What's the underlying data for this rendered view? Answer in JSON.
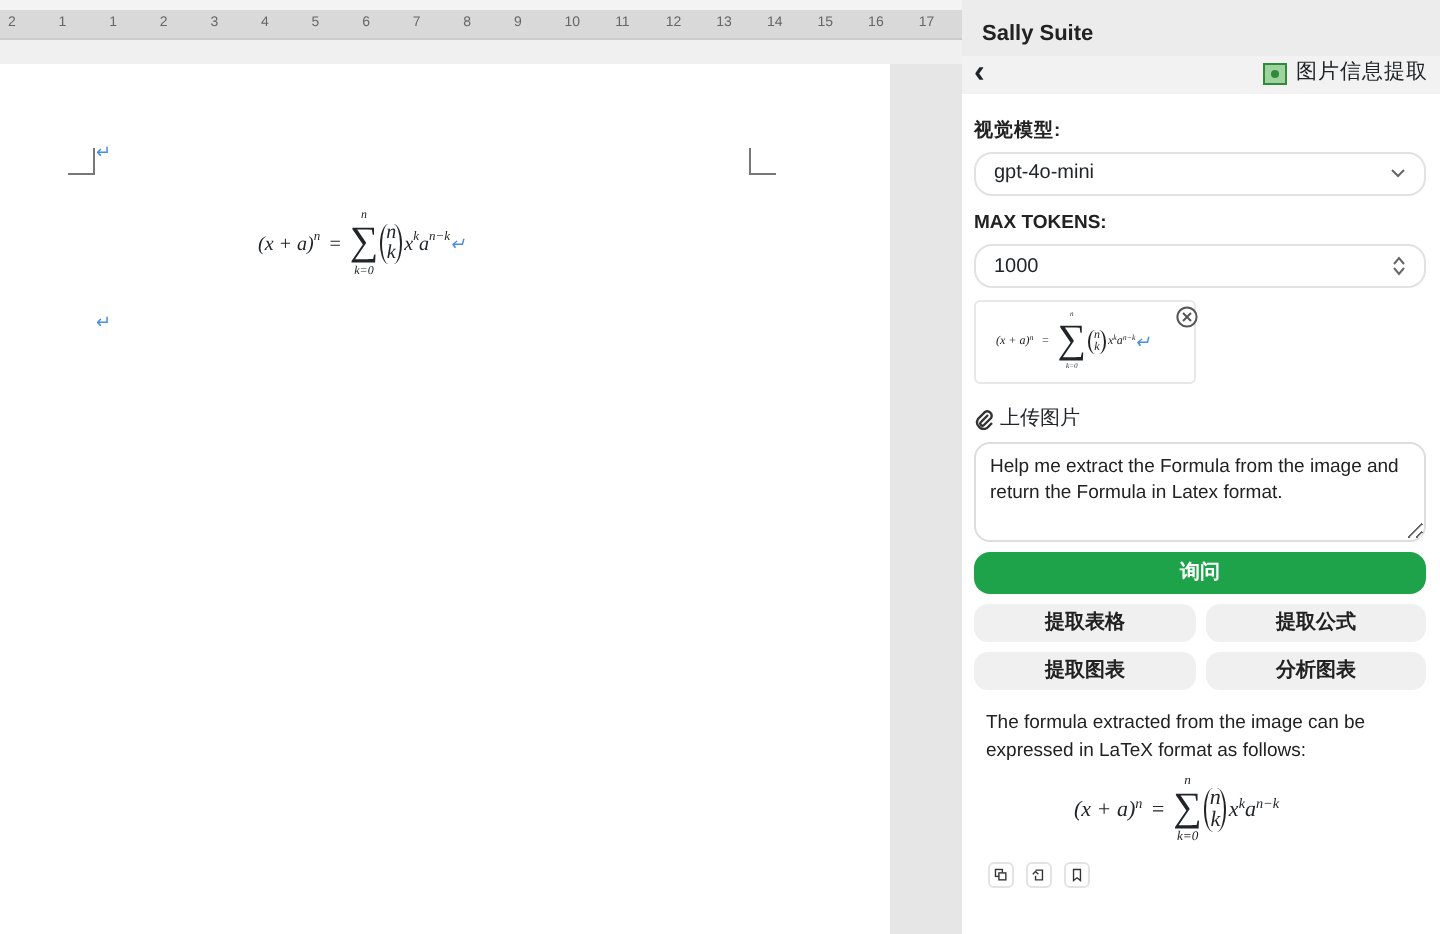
{
  "ruler": {
    "ticks": [
      "2",
      "1",
      "1",
      "2",
      "3",
      "4",
      "5",
      "6",
      "7",
      "8",
      "9",
      "10",
      "11",
      "12",
      "13",
      "14",
      "15",
      "16",
      "17"
    ]
  },
  "document": {
    "paragraph_marks": [
      "↵",
      "↵"
    ],
    "formula": {
      "lhs": "(x + a)",
      "lhs_exp": "n",
      "op": "=",
      "sum": "∑",
      "sum_upper": "n",
      "sum_lower": "k=0",
      "binom_top": "n",
      "binom_bottom": "k",
      "term": "x",
      "term_exp": "k",
      "term2": "a",
      "term2_exp": "n−k",
      "end_mark": "↵"
    }
  },
  "panel": {
    "title": "Sally Suite",
    "back": "‹",
    "feature": "图片信息提取",
    "model_label": "视觉模型:",
    "model_value": "gpt-4o-mini",
    "tokens_label": "MAX TOKENS:",
    "tokens_value": "1000",
    "thumbnail": {
      "lhs": "(x + a)",
      "lhs_exp": "n",
      "op": "=",
      "sum": "∑",
      "sum_upper": "n",
      "sum_lower": "k=0",
      "binom_top": "n",
      "binom_bottom": "k",
      "term": "x",
      "term_exp": "k",
      "term2": "a",
      "term2_exp": "n−k",
      "end_mark": "↵"
    },
    "upload_label": "上传图片",
    "prompt": "Help me extract the Formula from the image and return the Formula in Latex format.",
    "ask_button": "询问",
    "actions": [
      "提取表格",
      "提取公式",
      "提取图表",
      "分析图表"
    ],
    "answer": "The formula extracted from the image can be expressed in LaTeX format as follows:",
    "answer_formula": {
      "lhs": "(x + a)",
      "lhs_exp": "n",
      "op": "=",
      "sum": "∑",
      "sum_upper": "n",
      "sum_lower": "k=0",
      "binom_top": "n",
      "binom_bottom": "k",
      "term": "x",
      "term_exp": "k",
      "term2": "a",
      "term2_exp": "n−k"
    }
  }
}
